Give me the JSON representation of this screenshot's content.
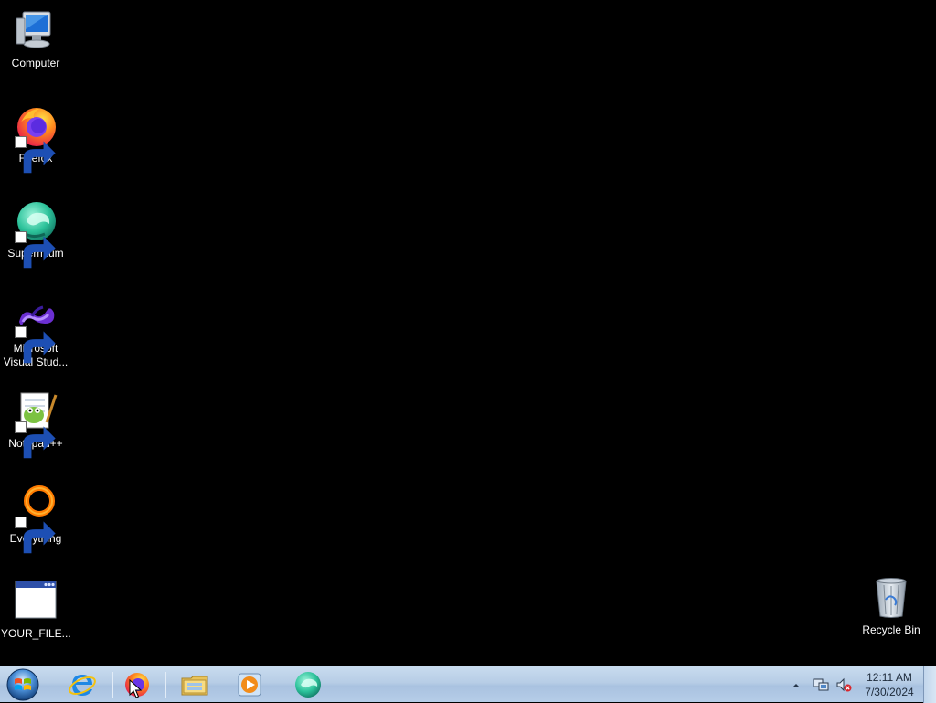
{
  "desktop": {
    "background_color": "#000000",
    "icons": [
      {
        "label": "Computer",
        "icon": "computer-icon",
        "shortcut": false
      },
      {
        "label": "Firefox",
        "icon": "firefox-icon",
        "shortcut": true
      },
      {
        "label": "Supermium",
        "icon": "supermium-icon",
        "shortcut": true
      },
      {
        "label": "Microsoft\nVisual Stud...",
        "icon": "visual-studio-icon",
        "shortcut": true
      },
      {
        "label": "Notepad++",
        "icon": "notepad-plus-plus-icon",
        "shortcut": true
      },
      {
        "label": "Everything",
        "icon": "everything-search-icon",
        "shortcut": true
      },
      {
        "label": "YOUR_FILE...",
        "icon": "window-file-icon",
        "shortcut": false
      },
      {
        "label": "Recycle Bin",
        "icon": "recycle-bin-icon",
        "shortcut": false
      }
    ]
  },
  "taskbar": {
    "start_icon": "windows-start-orb-icon",
    "pinned": [
      {
        "icon": "internet-explorer-icon"
      },
      {
        "icon": "firefox-icon"
      },
      {
        "icon": "file-explorer-icon"
      },
      {
        "icon": "media-player-icon"
      },
      {
        "icon": "supermium-icon"
      }
    ],
    "tray": {
      "icons": [
        "show-hidden-icons-arrow-icon",
        "network-icon",
        "volume-muted-icon"
      ],
      "time": "12:11 AM",
      "date": "7/30/2024"
    }
  },
  "colors": {
    "taskbar": "#b7cde6",
    "desktop": "#000000"
  }
}
